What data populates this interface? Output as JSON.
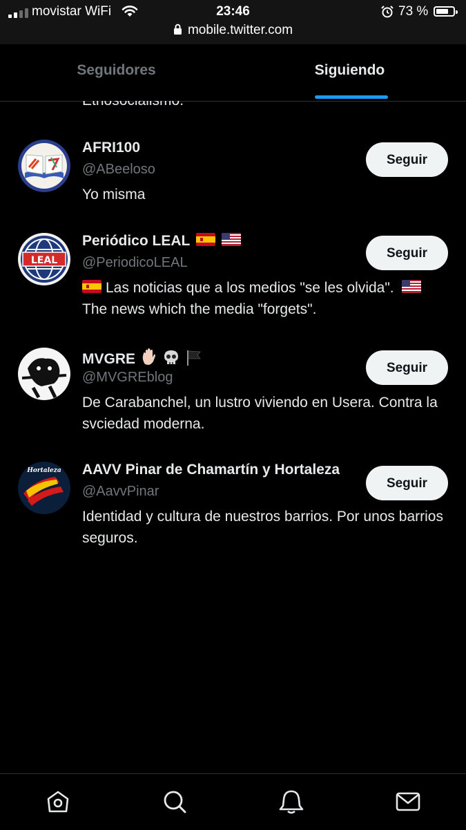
{
  "status_bar": {
    "carrier": "movistar WiFi",
    "time": "23:46",
    "battery_percent": "73 %",
    "battery_level": 0.73,
    "url": "mobile.twitter.com"
  },
  "tabs": [
    {
      "label": "Seguidores",
      "active": false
    },
    {
      "label": "Siguiendo",
      "active": true
    }
  ],
  "partial_bio": "Ethosocialismo.",
  "accounts": [
    {
      "name": "AFRI100",
      "handle": "@ABeeloso",
      "bio": "Yo misma",
      "button": "Seguir"
    },
    {
      "name": "Periódico LEAL",
      "handle": "@PeriodicoLEAL",
      "bio_text": "Las noticias que a los medios \"se les olvida\".",
      "bio_text2": "The news which the media \"forgets\".",
      "avatar_text": "LEAL",
      "button": "Seguir"
    },
    {
      "name": "MVGRE",
      "handle": "@MVGREblog",
      "bio": "De Carabanchel, un lustro viviendo en Usera. Contra la svciedad moderna.",
      "button": "Seguir"
    },
    {
      "name": "AAVV Pinar de Chamartín y Hortaleza",
      "handle": "@AavvPinar",
      "bio": "Identidad y cultura de nuestros barrios. Por unos barrios seguros.",
      "avatar_text": "Hortaleza",
      "button": "Seguir"
    }
  ],
  "colors": {
    "background": "#000000",
    "accent": "#1d9bf0",
    "secondary_text": "#71767b",
    "button_bg": "#eff3f4"
  },
  "bottom_nav": [
    {
      "icon": "home-icon"
    },
    {
      "icon": "search-icon"
    },
    {
      "icon": "bell-icon"
    },
    {
      "icon": "mail-icon"
    }
  ]
}
